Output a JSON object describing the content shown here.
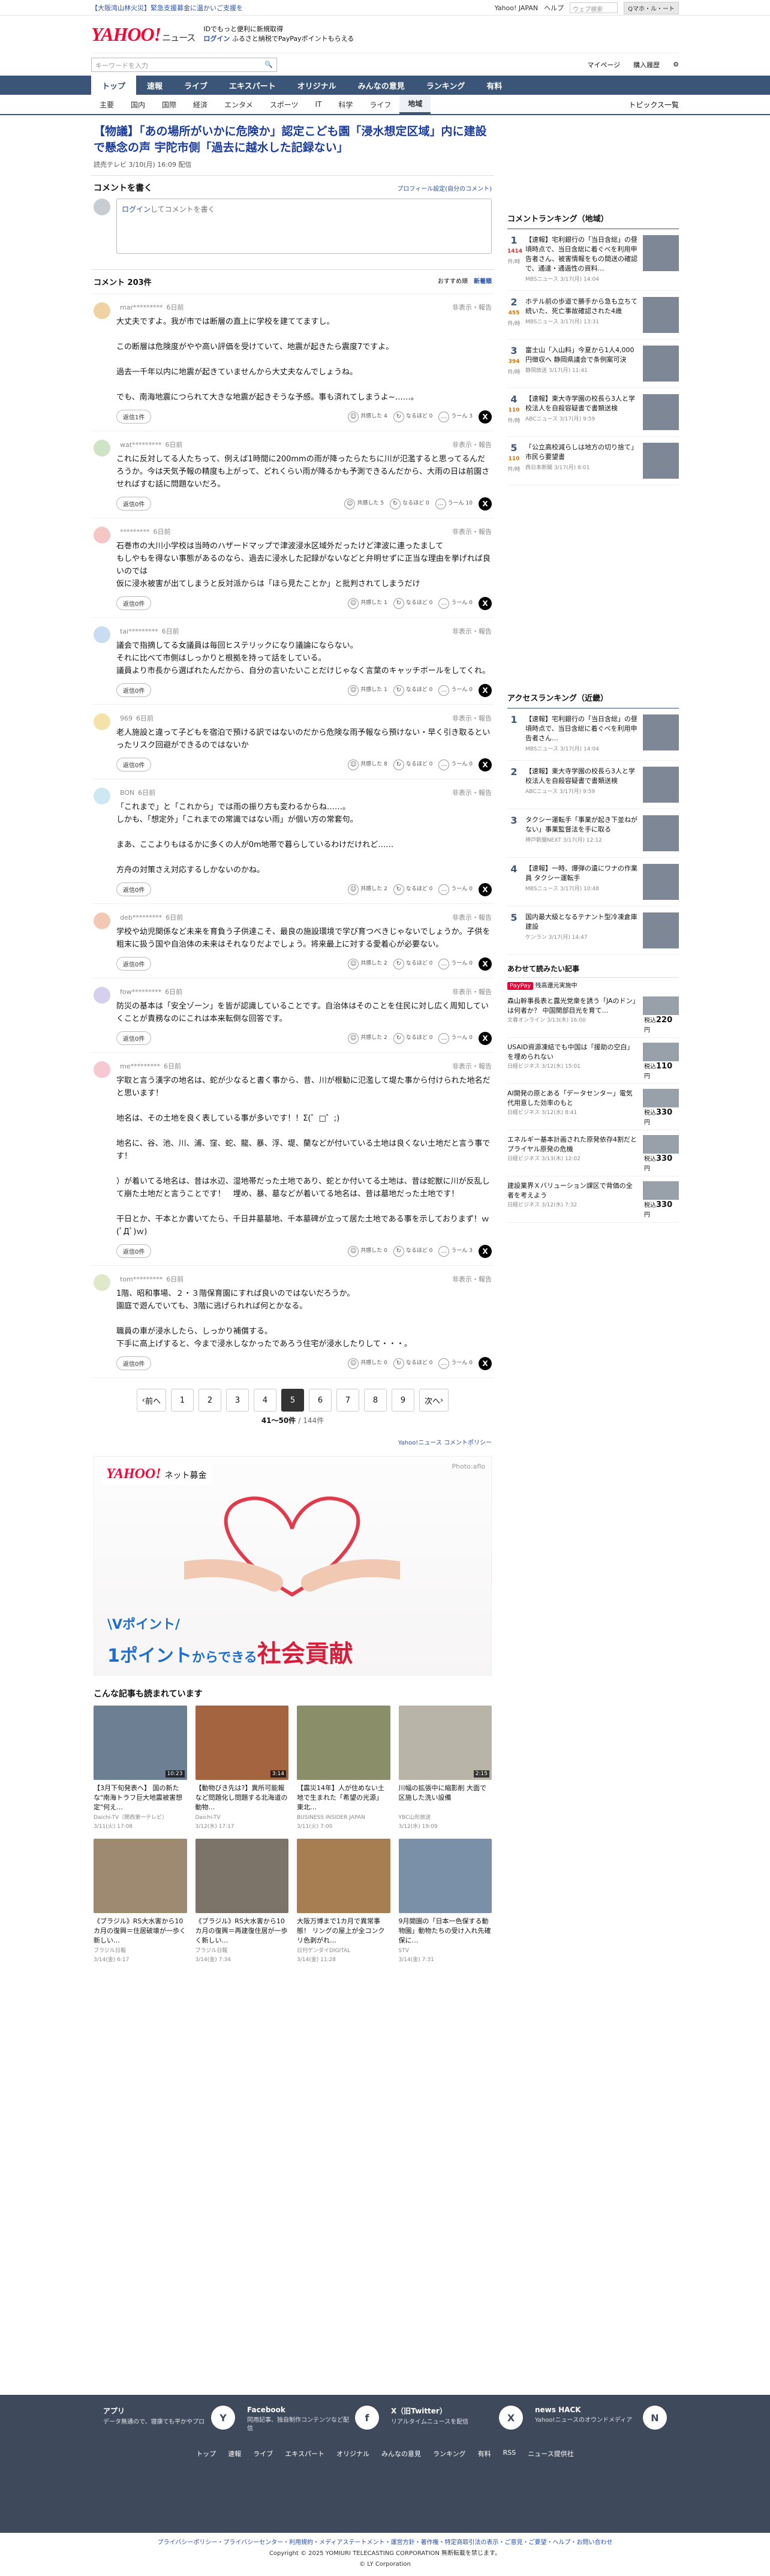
{
  "topbar": {
    "alert": "【大阪湾山林火災】緊急支援募金に温かいご支援を",
    "links": [
      "Yahoo! JAPAN",
      "ヘルプ"
    ],
    "search_placeholder": "ウェブ検索",
    "search_btn": "Qマホ・ル・ート"
  },
  "header": {
    "brand": "YAHOO!",
    "brand_sub": "ニュース",
    "promo1": "IDでもっと便利に新規取得",
    "promo2_login": "ログイン",
    "promo2": "ふるさと納税でPayPayポイントもらえる"
  },
  "search": {
    "placeholder": "キーワードを入力",
    "mypage": "マイページ",
    "purchase": "購入履歴"
  },
  "gnav": [
    "トップ",
    "速報",
    "ライブ",
    "エキスパート",
    "オリジナル",
    "みんなの意見",
    "ランキング",
    "有料"
  ],
  "snav": [
    "主要",
    "国内",
    "国際",
    "経済",
    "エンタメ",
    "スポーツ",
    "IT",
    "科学",
    "ライフ",
    "地域"
  ],
  "snav_more": "トピックス一覧",
  "article": {
    "title": "【物議】「あの場所がいかに危険か」認定こども園「浸水想定区域」内に建設で懸念の声 宇陀市側「過去に越水した記録ない」",
    "meta": "読売テレビ 3/10(月) 16:09 配信"
  },
  "comment_form": {
    "heading": "コメントを書く",
    "profile_link": "プロフィール設定(自分のコメント)",
    "login": "ログイン",
    "placeholder": "してコメントを書く"
  },
  "comments_header": {
    "count": "コメント 203件",
    "sort1": "おすすめ順",
    "sort2": "新着順"
  },
  "comments": [
    {
      "name": "mar*********",
      "time": "6日前",
      "report": "非表示・報告",
      "text": "大丈夫ですよ。我が市では断層の直上に学校を建ててますし。\n\nこの断層は危険度がやや高い評価を受けていて、地震が起きたら震度7ですよ。\n\n過去一千年以内に地震が起きていませんから大丈夫なんでしょうね。\n\nでも、南海地震につられて大きな地震が起きそうな予感。事も済れてしまうよ~……。",
      "replies": "返信1件",
      "r1": "共感した 4",
      "r2": "なるほど 0",
      "r3": "うーん 3"
    },
    {
      "name": "wat*********",
      "time": "6日前",
      "report": "非表示・報告",
      "text": "これに反対してる人たちって、例えば1時間に200mmの雨が降ったらたちに川が氾濫すると思ってるんだろうか。今は天気予報の精度も上がって、どれくらい雨が降るかも予測できるんだから、大雨の日は前園させればすむ話に問題ないだろ。",
      "replies": "返信0件",
      "r1": "共感した 5",
      "r2": "なるほど 0",
      "r3": "うーん 10"
    },
    {
      "name": "*********",
      "time": "6日前",
      "report": "非表示・報告",
      "text": "石巻市の大川小学校は当時のハザードマップで津波浸水区域外だったけど津波に連ったまして\nもしやもを得ない事態があるのなら、過去に浸水した記録がないなどと弁明せずに正当な理由を挙げれば良いのでは\n仮に浸水被害が出てしまうと反対派からは「ほら見たことか」と批判されてしまうだけ",
      "replies": "返信0件",
      "r1": "共感した 1",
      "r2": "なるほど 0",
      "r3": "うーん 0"
    },
    {
      "name": "tai*********",
      "time": "6日前",
      "report": "非表示・報告",
      "text": "議会で指摘してる女議員は毎回ヒステリックになり議論にならない。\nそれに比べて市側はしっかりと根拠を持って話をしている。\n議員より市長から選ばれたんだから、自分の言いたいことだけじゃなく言葉のキャッチボールをしてくれ。",
      "replies": "返信0件",
      "r1": "共感した 1",
      "r2": "なるほど 0",
      "r3": "うーん 0"
    },
    {
      "name": "969",
      "time": "6日前",
      "report": "非表示・報告",
      "text": "老人施設と違って子どもを宿泊で預ける訳ではないのだから危険な雨予報なら預けない・早く引き取るといったリスク回避ができるのではないか",
      "replies": "返信0件",
      "r1": "共感した 8",
      "r2": "なるほど 0",
      "r3": "うーん 0"
    },
    {
      "name": "BON",
      "time": "6日前",
      "report": "非表示・報告",
      "text": "「これまで」と「これから」では雨の振り方も変わるからね……。\nしかも、「想定外」「これまでの常識ではない雨」が個い方の常套句。\n\nまあ、ここよりもはるかに多くの人が0m地帯で暮らしているわけだけれど……\n\n方舟の対策さえ対応するしかないのかね。",
      "replies": "返信0件",
      "r1": "共感した 2",
      "r2": "なるほど 0",
      "r3": "うーん 0"
    },
    {
      "name": "deb*********",
      "time": "6日前",
      "report": "非表示・報告",
      "text": "学校や幼児関係など未来を育負う子供達こそ、最良の施設環境で学び育つべきじゃないでしょうか。子供を粗末に扱う国や自治体の未来はそれなりだよでしょう。将来最上に対する愛着心が必要ない。",
      "replies": "返信0件",
      "r1": "共感した 2",
      "r2": "なるほど 0",
      "r3": "うーん 0"
    },
    {
      "name": "fow*********",
      "time": "6日前",
      "report": "非表示・報告",
      "text": "防災の基本は「安全ゾーン」を皆が認識していることです。自治体はそのことを住民に対し広く周知していくことが責務なのにこれは本来転倒な回答です。",
      "replies": "返信0件",
      "r1": "共感した 2",
      "r2": "なるほど 0",
      "r3": "うーん 0"
    },
    {
      "name": "me*********",
      "time": "6日前",
      "report": "非表示・報告",
      "text": "字取と言う漢字の地名は、蛇が少なると書く事から、昔、川が根勧に氾濫して堤た事から付けられた地名だと思います！\n\n    地名は、その土地を良く表している事が多いです！！Σ(゜□゜;)\n\n    地名に、谷、池、川、浦、窪、蛇、龍、暴、浮、堤、蘭などが付いている土地は良くない土地だと言う事です！\n\n    ）が着いてる地名は、昔は水辺、湿地帯だった土地であり、蛇とか付いてる土地は、昔は蛇獣に川が反乱して崩た土地だと言うことです！　埋め、暴、墓などが着いてる地名は、昔は墓地だった土地です！\n\n    干日とか、干本とか書いてたら、千日井墓墓地、千本墓碑が立って居た土地である事を示しておりまず！ｗ(ﾟДﾟ)ｗ)",
      "replies": "返信0件",
      "r1": "共感した 0",
      "r2": "なるほど 0",
      "r3": "うーん 3"
    },
    {
      "name": "tom*********",
      "time": "6日前",
      "report": "非表示・報告",
      "text": "1階、昭和事場、２・３階保育園にすれば良いのではないだろうか。\n園庭で遊んでいても、3階に逃げられれば何とかなる。\n\n職員の車が浸水したら、しっかり補償する。\n下手に高上げすると、今まで浸水しなかったであろう住宅が浸水したりして・・・。",
      "replies": "返信0件",
      "r1": "共感した 0",
      "r2": "なるほど 0",
      "r3": "うーん 0"
    }
  ],
  "pager": {
    "prev": "前へ",
    "pages": [
      "1",
      "2",
      "3",
      "4",
      "5",
      "6",
      "7",
      "8",
      "9"
    ],
    "current": "5",
    "next": "次へ",
    "info": "41〜50件",
    "total": "/ 144件"
  },
  "policy": "Yahoo!ニュース コメントポリシー",
  "ad": {
    "brand": "YAHOO!",
    "brand_sub": "ネット募金",
    "photo": "Photo:aflo",
    "line1": "\\Vポイント/",
    "line2a": "1ポイント",
    "line2b": "からできる",
    "line2c": "社会貢献"
  },
  "also": {
    "heading": "こんな記事も読まれています",
    "items": [
      {
        "title": "【3月下旬発表へ】 国の新たな\"南海トラフ巨大地震被害想定\"何え…",
        "source": "Daichi-TV（関西第一テレビ）",
        "date": "3/11(火) 17:08",
        "dur": "10:23"
      },
      {
        "title": "【動物びき先は?】異所可能報など問題化し問題する北海道の動物…",
        "source": "Daichi-TV",
        "date": "3/12(水) 17:17",
        "dur": "3:14"
      },
      {
        "title": "【震災14年】人が住めない土地で生まれた「希望の光源」 東北…",
        "source": "BUSINESS INSIDER JAPAN",
        "date": "3/11(火) 7:00",
        "dur": ""
      },
      {
        "title": "川幅の拡張中に縮影削 大面で区施した洗い設備",
        "source": "YBC山形放送",
        "date": "3/12(水) 19:09",
        "dur": "2:15"
      },
      {
        "title": "《ブラジル》RS大水害から10カ月の復興＝住居破壊が一歩く新しい…",
        "source": "ブラジル日報",
        "date": "3/14(金) 6:17",
        "dur": ""
      },
      {
        "title": "《ブラジル》RS大水害から10カ月の復興＝再建復住居が一歩く新しい…",
        "source": "ブラジル日報",
        "date": "3/14(金) 7:34",
        "dur": ""
      },
      {
        "title": "大阪万博まで1カ月で異常事態！ リングの屋上が全コンクリ色剥がれ…",
        "source": "日刊ゲンダイDIGITAL",
        "date": "3/14(金) 11:28",
        "dur": ""
      },
      {
        "title": "9月開園の「日本一色保する動物園」動物たちの受け入れ先確保に…",
        "source": "STV",
        "date": "3/14(金) 7:31",
        "dur": ""
      }
    ]
  },
  "side": {
    "ranking_local": {
      "heading": "コメントランキング（地域）",
      "items": [
        {
          "n": "1",
          "c": "1414",
          "u": "件/時",
          "title": "【速報】宅利銀行の「当日含総」の昼頃時点で、当日含総に着ぐべを利用申告者さん、被害情報をもの間送の確認で、通達・通過性の資料…",
          "src": "MBSニュース 3/17(月) 14:04"
        },
        {
          "n": "2",
          "c": "455",
          "u": "件/時",
          "title": "ホテル前の歩道で勝手から急も立ちて続いた、死亡事故確認された4歳",
          "src": "MBSニュース 3/17(月) 13:31"
        },
        {
          "n": "3",
          "c": "394",
          "u": "件/時",
          "title": "富士山「入山料」今夏から1人4,000円徴収へ 静岡県議会で条例案可決",
          "src": "静岡放送 3/17(月) 11:41"
        },
        {
          "n": "4",
          "c": "110",
          "u": "件/時",
          "title": "【速報】東大寺学園の校長ら3人と学校法人を自殺容疑書で書類送検",
          "src": "ABCニュース 3/17(月) 9:59"
        },
        {
          "n": "5",
          "c": "110",
          "u": "件/時",
          "title": "「公立高校減らしは地方の切り捨て」　市民ら要望書",
          "src": "西日本新聞 3/17(月) 8:01"
        }
      ]
    },
    "ranking_access": {
      "heading": "アクセスランキング（近畿）",
      "items": [
        {
          "n": "1",
          "title": "【速報】宅利銀行の「当日含総」の昼頃時点で、当日含総に着ぐべを利用申告者さん…",
          "src": "MBSニュース 3/17(月) 14:04"
        },
        {
          "n": "2",
          "title": "【速報】東大寺学園の校長ら3人と学校法人を自殺容疑書で書類送検",
          "src": "ABCニュース 3/17(月) 9:59"
        },
        {
          "n": "3",
          "title": "タクシー運転手「事業が起き下並ねがない」事業監督法を手に取る",
          "src": "神戸新聞NEXT 3/17(月) 12:12"
        },
        {
          "n": "4",
          "title": "【速報】一時、爆弾の遺にワナの作業員 タクシー運転手",
          "src": "MBSニュース 3/17(月) 10:48"
        },
        {
          "n": "5",
          "title": "国内最大級となるテナント型冷凍倉庫建設",
          "src": "ケンラン 3/17(月) 14:47"
        }
      ]
    },
    "paypay": {
      "heading": "あわせて読みたい記事",
      "badge": "PayPay",
      "badge_txt": "残高還元実施中",
      "items": [
        {
          "title": "森山幹事長表と露光党衆を誘う「JAのドン」は何者か？ 中国関部目光を育て…",
          "src": "文春オンライン 3/13(木) 16:00",
          "price": "220"
        },
        {
          "title": "USAID資源凍結でも中国は「援助の空白」を埋められない",
          "src": "日経ビジネス 3/12(水) 15:01",
          "price": "110"
        },
        {
          "title": "AI開発の原とある「データセンター」電気代用意した効率のもと",
          "src": "日経ビジネス 3/12(水) 8:41",
          "price": "330"
        },
        {
          "title": "エネルギー基本計画された原発依存4割だとプライヤル原発の危機",
          "src": "日経ビジネス 3/13(木) 12:02",
          "price": "330"
        },
        {
          "title": "建設業界Ｘバリューション課区で背価の全者を考えよう",
          "src": "日経ビジネス 3/12(水) 7:32",
          "price": "330"
        }
      ]
    }
  },
  "footer": {
    "cols": [
      {
        "title": "アプリ",
        "desc": "データ無通ので、寝康ても平かやプロ",
        "icon": "Y"
      },
      {
        "title": "Facebook",
        "desc": "同用記事、独自制作コンテンツなど配信",
        "icon": "f"
      },
      {
        "title": "X（旧Twitter）",
        "desc": "リアルタイムニュースを配信",
        "icon": "X"
      },
      {
        "title": "news HACK",
        "desc": "Yahoo!ニュースのオウンドメディア",
        "icon": "N"
      }
    ],
    "nav": [
      "トップ",
      "速報",
      "ライブ",
      "エキスパート",
      "オリジナル",
      "みんなの意見",
      "ランキング",
      "有料",
      "RSS",
      "ニュース提供社"
    ],
    "legal1": "プライバシーポリシー・プライバシーセンター・利用規約・メディアステートメント・運営方針・著作権・特定商取引法の表示・ご意見・ご要望・ヘルプ・お問い合わせ",
    "legal2": "Copyright © 2025 YOMIURI TELECASTING CORPORATION 無断転載を禁じます。",
    "legal3": "© LY Corporation"
  }
}
